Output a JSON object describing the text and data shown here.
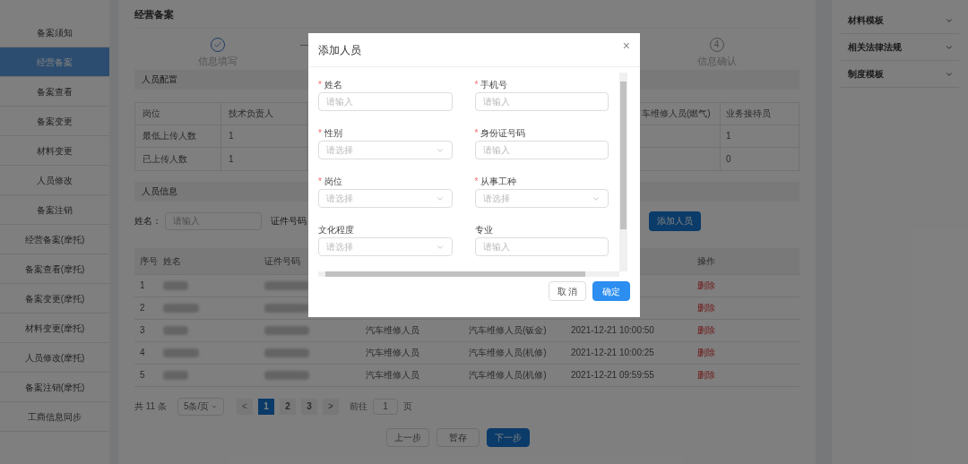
{
  "sidebar": {
    "items": [
      {
        "label": "备案须知",
        "selected": false
      },
      {
        "label": "经营备案",
        "selected": true
      },
      {
        "label": "备案查看",
        "selected": false
      },
      {
        "label": "备案变更",
        "selected": false
      },
      {
        "label": "材料变更",
        "selected": false
      },
      {
        "label": "人员修改",
        "selected": false
      },
      {
        "label": "备案注销",
        "selected": false
      },
      {
        "label": "经营备案(摩托)",
        "selected": false
      },
      {
        "label": "备案查看(摩托)",
        "selected": false
      },
      {
        "label": "备案变更(摩托)",
        "selected": false
      },
      {
        "label": "材料变更(摩托)",
        "selected": false
      },
      {
        "label": "人员修改(摩托)",
        "selected": false
      },
      {
        "label": "备案注销(摩托)",
        "selected": false
      },
      {
        "label": "工商信息同步",
        "selected": false
      }
    ]
  },
  "page_title": "经营备案",
  "steps": [
    {
      "kind": "done",
      "label": "信息填写"
    },
    {
      "kind": "number",
      "number": "4",
      "label": "信息确认"
    }
  ],
  "staff_config": {
    "title": "人员配置",
    "columns_left": [
      "岗位",
      "技术负责人"
    ],
    "columns_right": [
      "车维修人员(燃气)",
      "业务接待员"
    ],
    "rows": [
      {
        "cells": [
          "最低上传人数",
          "1"
        ],
        "last": "1"
      },
      {
        "cells": [
          "已上传人数",
          "1"
        ],
        "last": "0"
      }
    ]
  },
  "staff_info": {
    "title": "人员信息",
    "filters": [
      {
        "label": "姓名：",
        "placeholder": "请输入"
      },
      {
        "label": "证件号码："
      }
    ],
    "add_button": "添加人员",
    "columns_left": [
      "序号",
      "姓名",
      "证件号码"
    ],
    "column_action": "操作",
    "rows": [
      {
        "index": "1",
        "action": "删除"
      },
      {
        "index": "2",
        "action": "删除"
      },
      {
        "index": "3",
        "job": "汽车维修人员",
        "trade": "汽车维修人员(钣金)",
        "time": "2021-12-21 10:00:50",
        "action": "删除"
      },
      {
        "index": "4",
        "job": "汽车维修人员",
        "trade": "汽车维修人员(机修)",
        "time": "2021-12-21 10:00:25",
        "action": "删除"
      },
      {
        "index": "5",
        "job": "汽车维修人员",
        "trade": "汽车维修人员(机修)",
        "time": "2021-12-21 09:59:55",
        "action": "删除"
      }
    ]
  },
  "pagination": {
    "total": "共 11 条",
    "page_size": "5条/页",
    "prev": "<",
    "pages": [
      {
        "label": "1",
        "selected": true
      },
      {
        "label": "2",
        "selected": false
      },
      {
        "label": "3",
        "selected": false
      }
    ],
    "next": ">",
    "goto": "前往",
    "goto_value": "1",
    "goto_suffix": "页"
  },
  "footer_buttons": [
    {
      "label": "上一步",
      "kind": "default"
    },
    {
      "label": "暂存",
      "kind": "default"
    },
    {
      "label": "下一步",
      "kind": "primary"
    }
  ],
  "right_panel": {
    "items": [
      {
        "label": "材料模板",
        "expanded": false
      },
      {
        "label": "相关法律法规",
        "expanded": false
      },
      {
        "label": "制度模板",
        "expanded": false
      }
    ]
  },
  "dialog": {
    "title": "添加人员",
    "close": "×",
    "required_mark": "*",
    "fields": [
      {
        "label": "姓名",
        "required": true,
        "kind": "input",
        "placeholder": "请输入"
      },
      {
        "label": "手机号",
        "required": true,
        "kind": "input",
        "placeholder": "请输入"
      },
      {
        "label": "性别",
        "required": true,
        "kind": "select",
        "placeholder": "请选择"
      },
      {
        "label": "身份证号码",
        "required": true,
        "kind": "input",
        "placeholder": "请输入"
      },
      {
        "label": "岗位",
        "required": true,
        "kind": "select",
        "placeholder": "请选择"
      },
      {
        "label": "从事工种",
        "required": true,
        "kind": "select",
        "placeholder": "请选择"
      },
      {
        "label": "文化程度",
        "required": false,
        "kind": "select",
        "placeholder": "请选择"
      },
      {
        "label": "专业",
        "required": false,
        "kind": "input",
        "placeholder": "请输入"
      }
    ],
    "buttons": [
      {
        "label": "取 消",
        "kind": "default"
      },
      {
        "label": "确定",
        "kind": "primary"
      }
    ]
  }
}
